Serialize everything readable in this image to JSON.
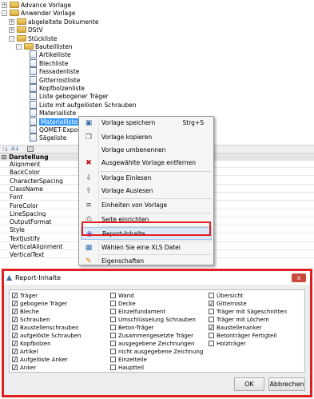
{
  "tree": {
    "items": [
      {
        "label": "Advance Vorlage",
        "expander": "+",
        "icon": "folder"
      },
      {
        "label": "Anwender Vorlage",
        "expander": "-",
        "icon": "folder"
      },
      {
        "label": "abgeleitete Dokumente",
        "expander": "+",
        "icon": "folder"
      },
      {
        "label": "DStV",
        "expander": "+",
        "icon": "folder"
      },
      {
        "label": "Stückliste",
        "expander": "-",
        "icon": "folder"
      },
      {
        "label": "Bauteillisten",
        "expander": "-",
        "icon": "folder"
      },
      {
        "label": "Artikelliste",
        "icon": "document"
      },
      {
        "label": "Blechliste",
        "icon": "document"
      },
      {
        "label": "Fassadenliste",
        "icon": "document"
      },
      {
        "label": "Gitterrostliste",
        "icon": "document"
      },
      {
        "label": "Kopfbolzenliste",
        "icon": "document"
      },
      {
        "label": "Liste gebogener Träger",
        "icon": "document"
      },
      {
        "label": "Liste mit aufgelösten Schrauben",
        "icon": "document"
      },
      {
        "label": "Materialliste",
        "icon": "document"
      },
      {
        "label": "Materialliste Sum",
        "icon": "document",
        "selected": true
      },
      {
        "label": "QOMET-Exportlist",
        "icon": "document"
      },
      {
        "label": "Sägeliste",
        "icon": "document"
      }
    ]
  },
  "properties": {
    "category": "Darstellung",
    "rows": [
      "Alignment",
      "BackColor",
      "CharacterSpacing",
      "ClassName",
      "Font",
      "ForeColor",
      "LineSpacing",
      "OutputFormat",
      "Style",
      "TextJustify",
      "VerticalAlignment",
      "VerticalText"
    ]
  },
  "context_menu": {
    "items": [
      {
        "label": "Vorlage speichern",
        "shortcut": "Strg+S",
        "icon": "save-icon"
      },
      {
        "label": "Vorlage kopieren",
        "icon": "copy-icon"
      },
      {
        "label": "Vorlage umbenennen",
        "icon": ""
      },
      {
        "label": "Ausgewählte Vorlage entfernen",
        "icon": "delete-icon"
      },
      {
        "label": "Vorlage Einlesen",
        "icon": "import-icon"
      },
      {
        "label": "Vorlage Auslesen",
        "icon": "export-icon"
      },
      {
        "label": "Einheiten von Vorlage",
        "icon": "units-icon"
      },
      {
        "label": "Seite einrichten",
        "icon": "page-setup-icon"
      },
      {
        "label": "Report-Inhalte",
        "icon": "report-content-icon"
      },
      {
        "label": "Wählen Sie eine XLS Datei",
        "icon": "xls-icon"
      },
      {
        "label": "Eigenschaften",
        "icon": "properties-icon"
      }
    ]
  },
  "dialog": {
    "title": "Report-Inhalte",
    "close_glyph": "x",
    "col1": [
      {
        "label": "Träger",
        "checked": true
      },
      {
        "label": "gebogene Träger",
        "checked": true
      },
      {
        "label": "Bleche",
        "checked": true
      },
      {
        "label": "Schrauben",
        "checked": true
      },
      {
        "label": "Baustellenschrauben",
        "checked": true
      },
      {
        "label": "aufgelöste Schrauben",
        "checked": true
      },
      {
        "label": "Kopfbolzen",
        "checked": true
      },
      {
        "label": "Artikel",
        "checked": true
      },
      {
        "label": "Aufgelöste Anker",
        "checked": true
      },
      {
        "label": "Anker",
        "checked": true
      }
    ],
    "col2": [
      {
        "label": "Wand",
        "checked": false
      },
      {
        "label": "Decke",
        "checked": false
      },
      {
        "label": "Einzelfundament",
        "checked": false
      },
      {
        "label": "Umschlüsselung Schrauben",
        "checked": false
      },
      {
        "label": "Beton-Träger",
        "checked": false
      },
      {
        "label": "Zusammengesetzte Träger",
        "checked": false
      },
      {
        "label": "ausgegebene Zeichnungen",
        "checked": false
      },
      {
        "label": "nicht ausgegebene Zeichnung",
        "checked": false
      },
      {
        "label": "Einzelteile",
        "checked": false
      },
      {
        "label": "Hauptteil",
        "checked": false
      }
    ],
    "col3": [
      {
        "label": "Übersicht",
        "checked": false
      },
      {
        "label": "Gitterroste",
        "checked": true
      },
      {
        "label": "Träger mit Sägeschnitten",
        "checked": false
      },
      {
        "label": "Träger mit Löchern",
        "checked": false
      },
      {
        "label": "Baustellenanker",
        "checked": true
      },
      {
        "label": "Betonträger Fertigteil",
        "checked": false
      },
      {
        "label": "Holzträger",
        "checked": false
      }
    ],
    "ok_label": "OK",
    "cancel_label": "Abbrechen"
  },
  "colors": {
    "highlight": "#3399ff",
    "annotation": "#e02020",
    "dialog_close": "#c94a3d"
  }
}
